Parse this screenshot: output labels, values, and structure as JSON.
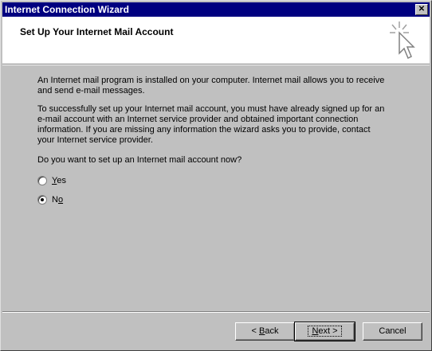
{
  "window": {
    "title": "Internet Connection Wizard",
    "close_label": "✕"
  },
  "header": {
    "title": "Set Up Your Internet Mail Account",
    "icon": "wizard-cursor-icon"
  },
  "content": {
    "paragraph1": "An Internet mail program is installed on your computer. Internet mail allows you to receive and send e-mail messages.",
    "paragraph2": "To successfully set up your Internet mail account, you must have already signed up for an e-mail account with an Internet service provider and obtained important connection information. If you are missing any information the wizard asks you to provide, contact your Internet service provider.",
    "question": "Do you want to set up an Internet mail account now?",
    "options": [
      {
        "label_key": "Y",
        "label_rest": "es",
        "selected": false
      },
      {
        "label_pre": "N",
        "label_key": "o",
        "selected": true
      }
    ]
  },
  "buttons": {
    "back_prefix": "< ",
    "back_key": "B",
    "back_rest": "ack",
    "next_key": "N",
    "next_rest": "ext >",
    "cancel": "Cancel"
  }
}
